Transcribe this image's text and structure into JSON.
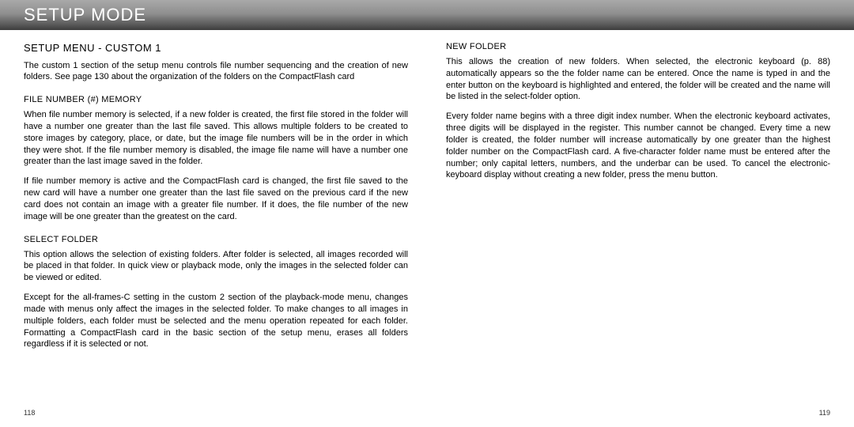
{
  "header": {
    "title": "Setup Mode"
  },
  "left": {
    "title": "SETUP MENU - CUSTOM 1",
    "intro": "The custom 1 section of the setup menu controls file number sequencing and the creation of new folders. See page 130 about the organization of the folders on the CompactFlash card",
    "file_number": {
      "heading": "FILE NUMBER (#) MEMORY",
      "p1": "When file number memory is selected, if a new folder is created, the first file stored in the folder will have a number one greater than the last file saved. This allows multiple folders to be created to store images by category, place, or date, but the image file numbers will be in the order in which they were shot. If the file number memory is disabled, the image file name will have a number one greater than the last image saved in the folder.",
      "p2": "If file number memory is active and the CompactFlash card is changed, the first file saved to the new card will have a number one greater than the last file saved on the previous card if the new card does not contain an image with a greater file number. If it does, the file number of the new image will be one greater than the greatest on the card."
    },
    "select_folder": {
      "heading": "SELECT FOLDER",
      "p1": "This option allows the selection of existing folders. After folder is selected, all images recorded will be placed in that folder. In quick view or playback mode, only the images in the selected folder can be viewed or edited.",
      "p2": "Except for the all-frames-C setting in the custom 2 section of the playback-mode menu, changes made with menus only affect the images in the selected folder. To make changes to all images in multiple folders, each folder must be selected and the menu operation repeated for each folder. Formatting a CompactFlash card in the basic section of the setup menu, erases all folders regardless if it is selected or not."
    },
    "page": "118"
  },
  "right": {
    "new_folder": {
      "heading": "NEW FOLDER",
      "p1": "This allows the creation of new folders. When selected, the electronic keyboard (p. 88) automatically appears so the the folder name can be entered. Once the name is typed in and the enter button on the keyboard is highlighted and entered, the folder will be created and the name will be listed in the select-folder option.",
      "p2": "Every folder name begins with a three digit index number. When the electronic keyboard activates, three digits will be displayed in the register. This number cannot be changed. Every time a new folder is created, the folder number will increase automatically by one greater than the highest folder number on the CompactFlash card. A five-character folder name must be entered after the number; only capital letters, numbers, and the underbar can be used. To cancel the electronic-keyboard display without creating a new folder, press the menu button."
    },
    "page": "119"
  }
}
